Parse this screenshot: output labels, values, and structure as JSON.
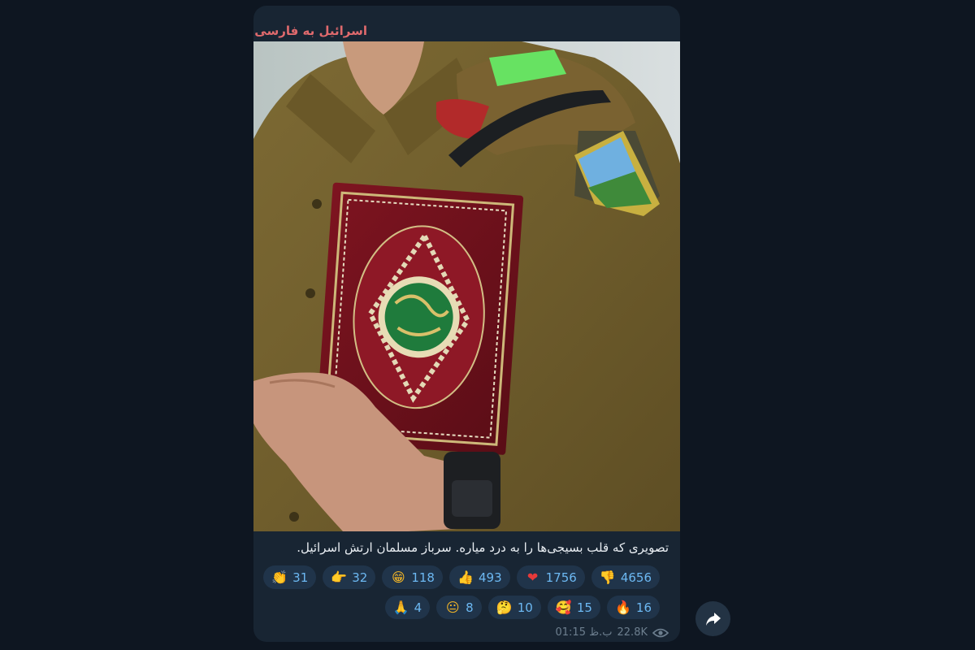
{
  "channel": {
    "name": "اسرائیل به فارسی"
  },
  "post": {
    "caption": "تصویری که قلب بسیجی‌ها را به درد میاره. سرباز مسلمان ارتش اسرائیل.",
    "views": "22.8K",
    "time": "01:15 ب.ظ"
  },
  "reactions": [
    {
      "emoji": "👎",
      "icon": "thumbs-down-icon",
      "count": "4656",
      "cls": "r-dislike"
    },
    {
      "emoji": "❤",
      "icon": "heart-icon",
      "count": "1756",
      "cls": "r-heart"
    },
    {
      "emoji": "👍",
      "icon": "thumbs-up-icon",
      "count": "493",
      "cls": "r-like"
    },
    {
      "emoji": "😁",
      "icon": "grin-icon",
      "count": "118",
      "cls": "r-grin"
    },
    {
      "emoji": "👉",
      "icon": "pointing-hand-icon",
      "count": "32",
      "cls": "r-point"
    },
    {
      "emoji": "👏",
      "icon": "clap-icon",
      "count": "31",
      "cls": "r-clap"
    },
    {
      "emoji": "🔥",
      "icon": "fire-icon",
      "count": "16",
      "cls": "r-fire"
    },
    {
      "emoji": "🥰",
      "icon": "smiling-hearts-icon",
      "count": "15",
      "cls": "r-love"
    },
    {
      "emoji": "🤔",
      "icon": "thinking-face-icon",
      "count": "10",
      "cls": "r-think"
    },
    {
      "emoji": "😐",
      "icon": "neutral-face-icon",
      "count": "8",
      "cls": "r-neutral"
    },
    {
      "emoji": "🙏",
      "icon": "pray-icon",
      "count": "4",
      "cls": "r-pray"
    }
  ],
  "colors": {
    "background": "#0e1621",
    "bubble": "#182533",
    "channel_name": "#e06a6d",
    "reaction_bg": "#20344a",
    "reaction_text": "#6cb8f2",
    "meta_text": "#6d7f8f"
  }
}
